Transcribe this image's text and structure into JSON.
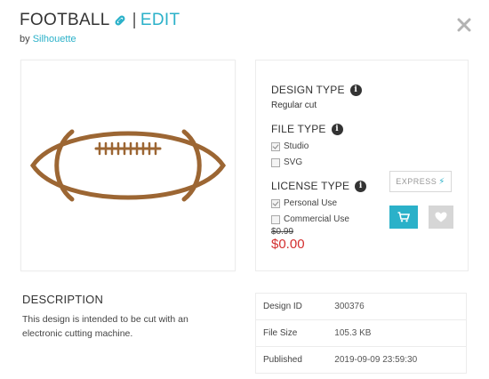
{
  "header": {
    "title": "FOOTBALL",
    "separator": "|",
    "edit_label": "EDIT",
    "by_prefix": "by",
    "author": "Silhouette"
  },
  "design_type": {
    "heading": "DESIGN TYPE",
    "value": "Regular cut"
  },
  "file_type": {
    "heading": "FILE TYPE",
    "options": [
      {
        "label": "Studio",
        "checked": true
      },
      {
        "label": "SVG",
        "checked": false
      }
    ]
  },
  "license_type": {
    "heading": "LICENSE TYPE",
    "options": [
      {
        "label": "Personal Use",
        "checked": true
      },
      {
        "label": "Commercial Use",
        "checked": false
      }
    ]
  },
  "price": {
    "original": "$0.99",
    "current": "$0.00"
  },
  "actions": {
    "express_label": "EXPRESS",
    "cart_icon": "cart-icon",
    "favorite_icon": "heart-icon"
  },
  "description": {
    "heading": "DESCRIPTION",
    "text": "This design is intended to be cut with an electronic cutting machine."
  },
  "details": [
    {
      "label": "Design ID",
      "value": "300376"
    },
    {
      "label": "File Size",
      "value": "105.3 KB"
    },
    {
      "label": "Published",
      "value": "2019-09-09 23:59:30"
    }
  ],
  "colors": {
    "accent": "#2bb1c9",
    "price": "#d32f2f",
    "football": "#9c6633"
  }
}
